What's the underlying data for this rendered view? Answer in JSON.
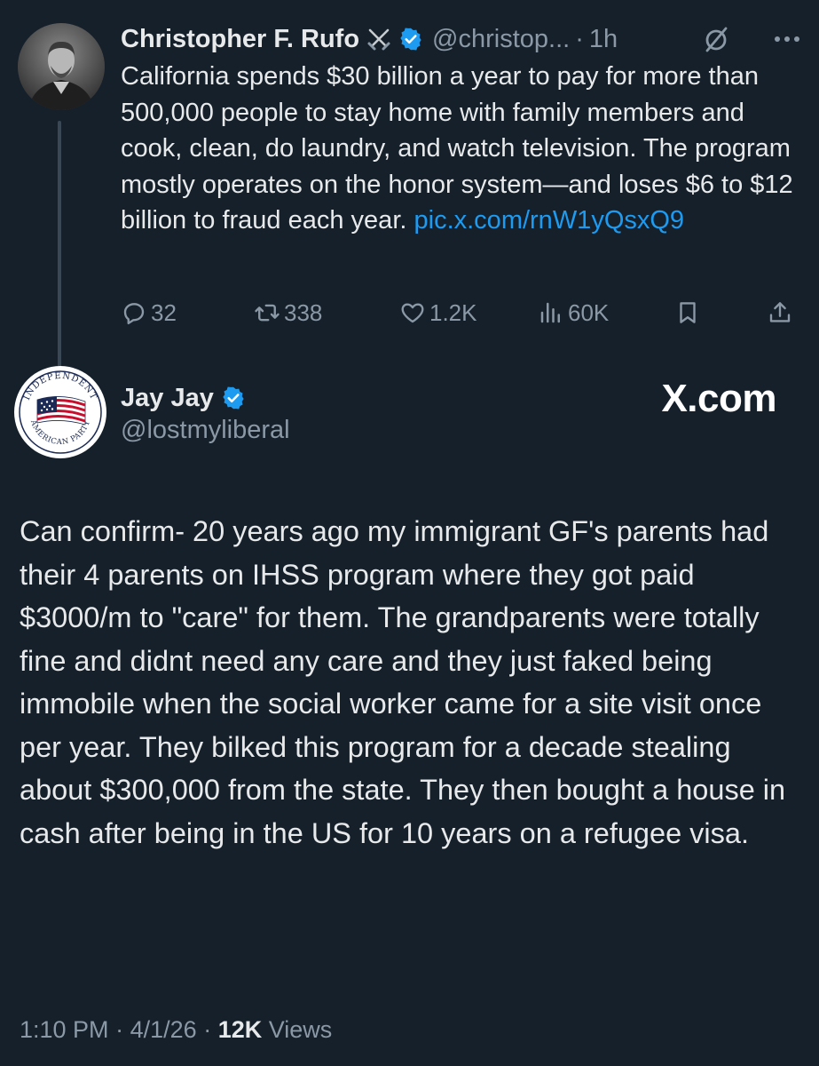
{
  "parent_tweet": {
    "author_name": "Christopher F. Rufo",
    "handle": "@christop...",
    "separator": "·",
    "time": "1h",
    "text": "California spends $30 billion a year to pay for more than 500,000 people to stay home with family members and cook, clean, do laundry, and watch television. The program mostly operates on the honor system—and loses $6 to $12 billion to fraud each year.",
    "link_text": "pic.x.com/rnW1yQsxQ9",
    "replies": "32",
    "reposts": "338",
    "likes": "1.2K",
    "views": "60K",
    "icons": {
      "badge": "crossed-swords-icon",
      "verified": "verified-badge-icon",
      "grok": "grok-icon",
      "more": "more-icon",
      "reply": "reply-icon",
      "repost": "repost-icon",
      "like": "heart-icon",
      "views": "views-icon",
      "bookmark": "bookmark-icon",
      "share": "share-icon"
    }
  },
  "reply_tweet": {
    "author_name": "Jay Jay",
    "handle": "@lostmyliberal",
    "watermark": "X.com",
    "text": "Can confirm-  20 years ago my immigrant GF's parents had their 4 parents on IHSS program where they got paid $3000/m to \"care\" for them.  The grandparents were totally fine and didnt need any care and they just faked being immobile when the social worker came for a site visit once per year.  They bilked this program for a decade stealing about $300,000 from the state.  They then bought a house in cash after being in the US for 10 years on a refugee visa.",
    "avatar_text_top": "INDEPENDENT",
    "avatar_text_bottom": "AMERICAN PARTY",
    "time": "1:10 PM",
    "date": "4/1/26",
    "separator": "·",
    "views_count": "12K",
    "views_label": "Views"
  },
  "colors": {
    "background": "#15202b",
    "text_primary": "#e7e9ea",
    "text_secondary": "#8b98a5",
    "link": "#1d9bf0",
    "verified": "#1d9bf0"
  }
}
